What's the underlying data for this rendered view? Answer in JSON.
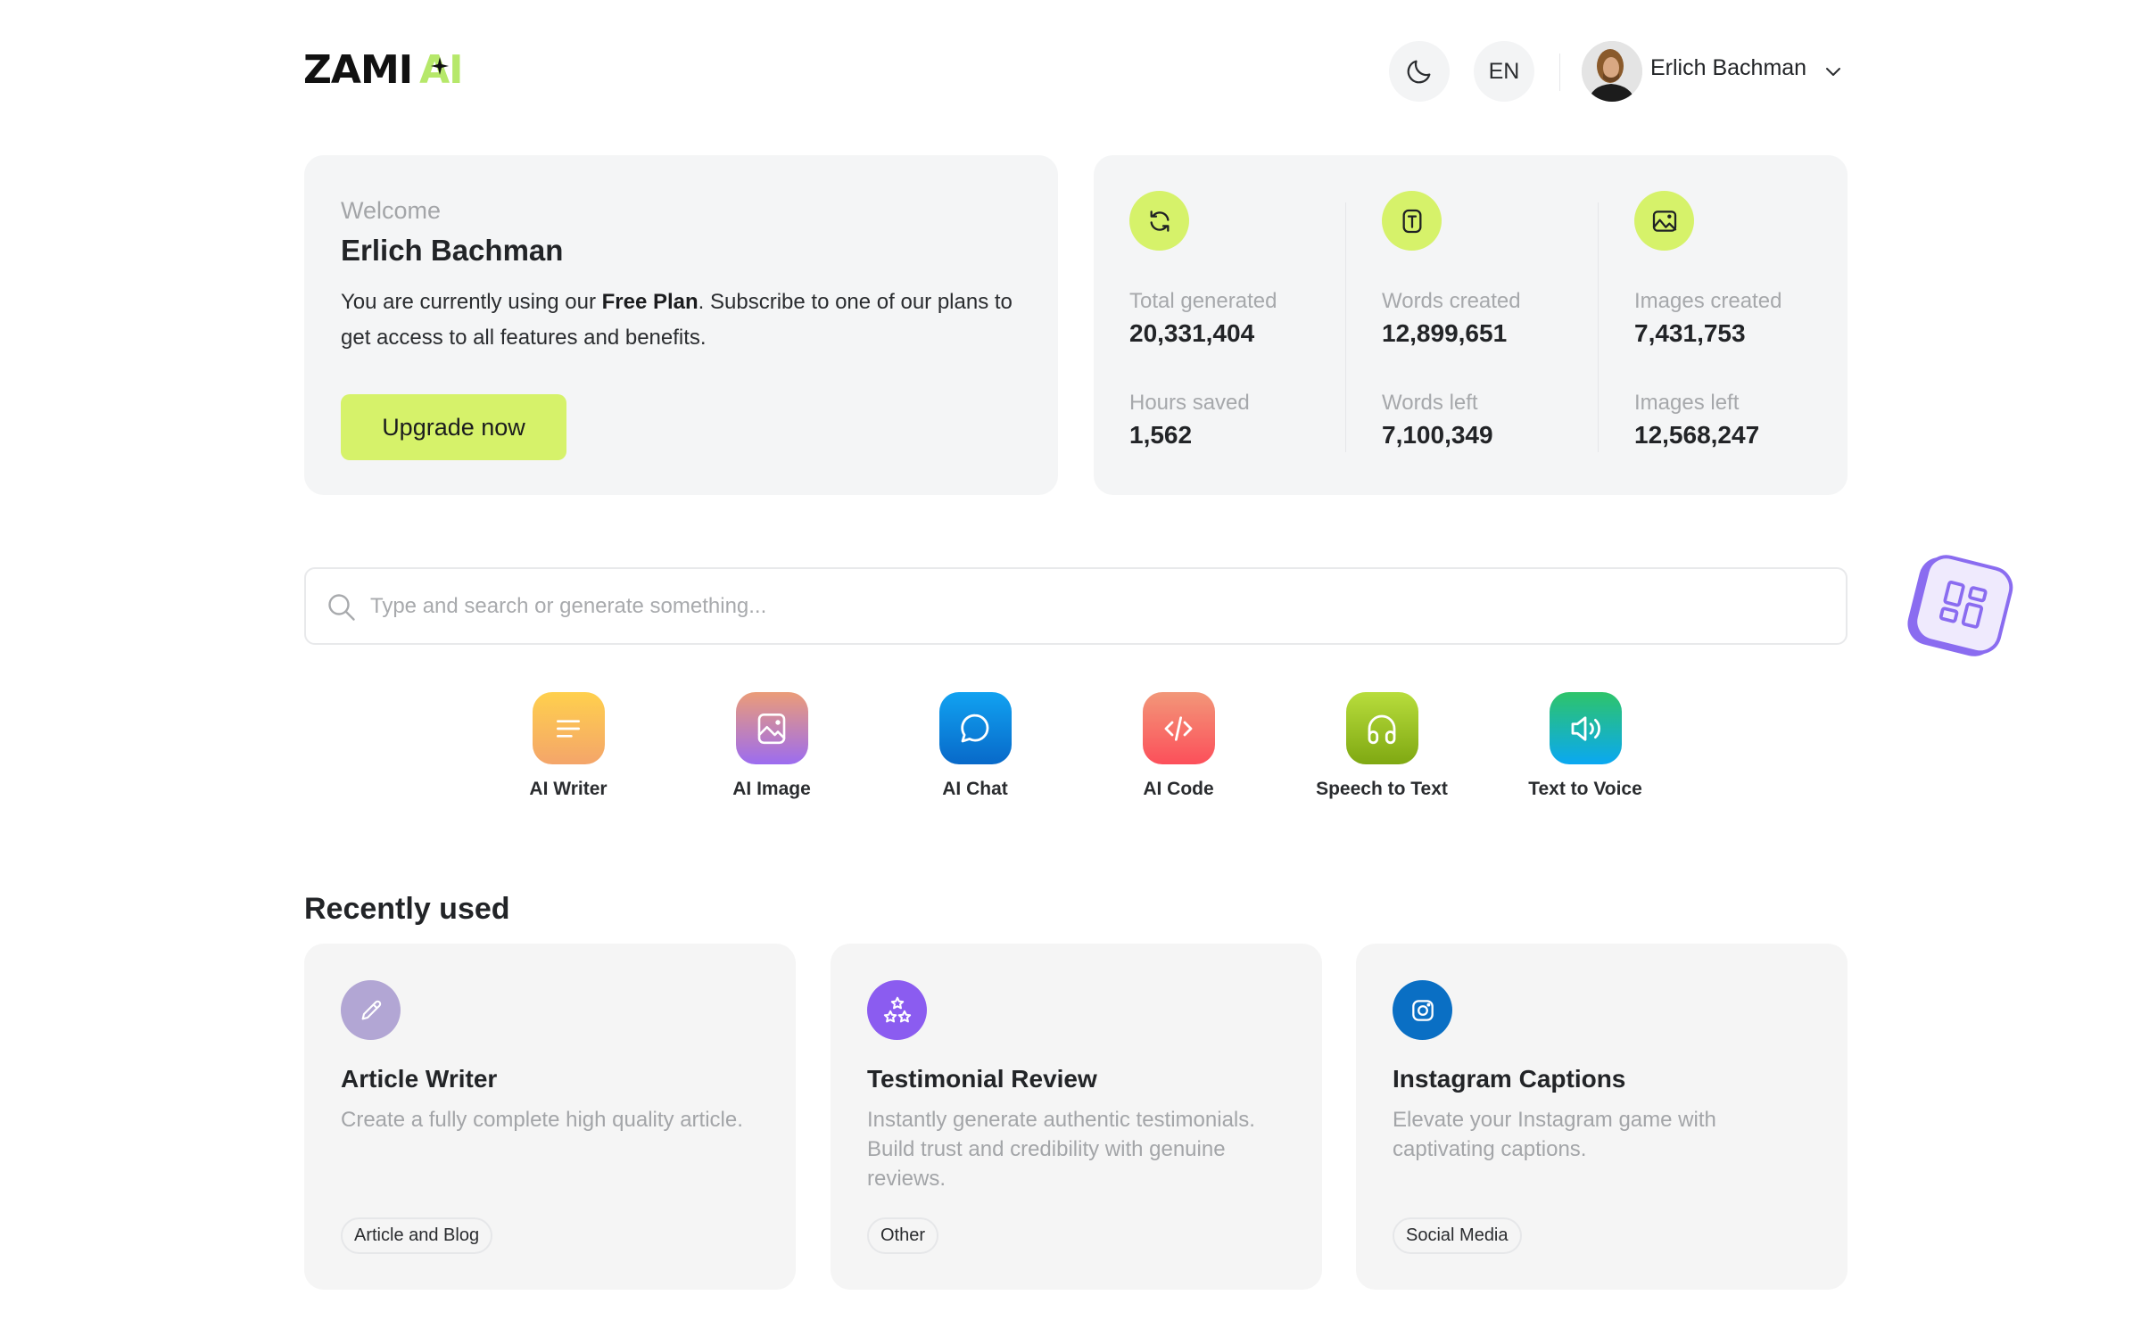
{
  "header": {
    "logo": {
      "text_main": "ZAMI",
      "text_accent": "AI"
    },
    "theme_toggle_icon": "moon-icon",
    "language": "EN",
    "user": {
      "name": "Erlich Bachman",
      "menu_icon": "chevron-down-icon"
    }
  },
  "welcome": {
    "label": "Welcome",
    "name": "Erlich Bachman",
    "message_prefix": "You are currently using our ",
    "plan": "Free Plan",
    "message_suffix": ". Subscribe to one of our plans to get access to all features and benefits.",
    "upgrade_label": "Upgrade now"
  },
  "stats": {
    "columns": [
      {
        "icon": "refresh-icon",
        "items": [
          {
            "label": "Total generated",
            "value": "20,331,404"
          },
          {
            "label": "Hours saved",
            "value": "1,562"
          }
        ]
      },
      {
        "icon": "text-icon",
        "items": [
          {
            "label": "Words created",
            "value": "12,899,651"
          },
          {
            "label": "Words left",
            "value": "7,100,349"
          }
        ]
      },
      {
        "icon": "image-icon",
        "items": [
          {
            "label": "Images created",
            "value": "7,431,753"
          },
          {
            "label": "Images left",
            "value": "12,568,247"
          }
        ]
      }
    ]
  },
  "search": {
    "placeholder": "Type and search or generate something...",
    "value": ""
  },
  "floating_widget": {
    "icon": "apps-grid-icon"
  },
  "tools": [
    {
      "label": "AI Writer",
      "icon": "lines-icon"
    },
    {
      "label": "AI Image",
      "icon": "image-icon"
    },
    {
      "label": "AI Chat",
      "icon": "chat-bubble-icon"
    },
    {
      "label": "AI Code",
      "icon": "code-icon"
    },
    {
      "label": "Speech to Text",
      "icon": "headphones-icon"
    },
    {
      "label": "Text to Voice",
      "icon": "speaker-icon"
    }
  ],
  "recently_used": {
    "title": "Recently used",
    "items": [
      {
        "title": "Article Writer",
        "description": "Create a fully complete high quality article.",
        "tag": "Article and Blog",
        "icon": "pencil-icon",
        "icon_color": "#b2a6d4"
      },
      {
        "title": "Testimonial Review",
        "description": "Instantly generate authentic testimonials. Build trust and credibility with genuine reviews.",
        "tag": "Other",
        "icon": "stars-icon",
        "icon_color": "#8b5cf0"
      },
      {
        "title": "Instagram Captions",
        "description": "Elevate your Instagram game with captivating captions.",
        "tag": "Social Media",
        "icon": "instagram-icon",
        "icon_color": "#0a6fc4"
      }
    ]
  },
  "colors": {
    "accent": "#d6f26a",
    "logo_accent": "#b6e86a",
    "card_bg": "#f4f5f6",
    "widget_purple": "#8a6cf0"
  }
}
